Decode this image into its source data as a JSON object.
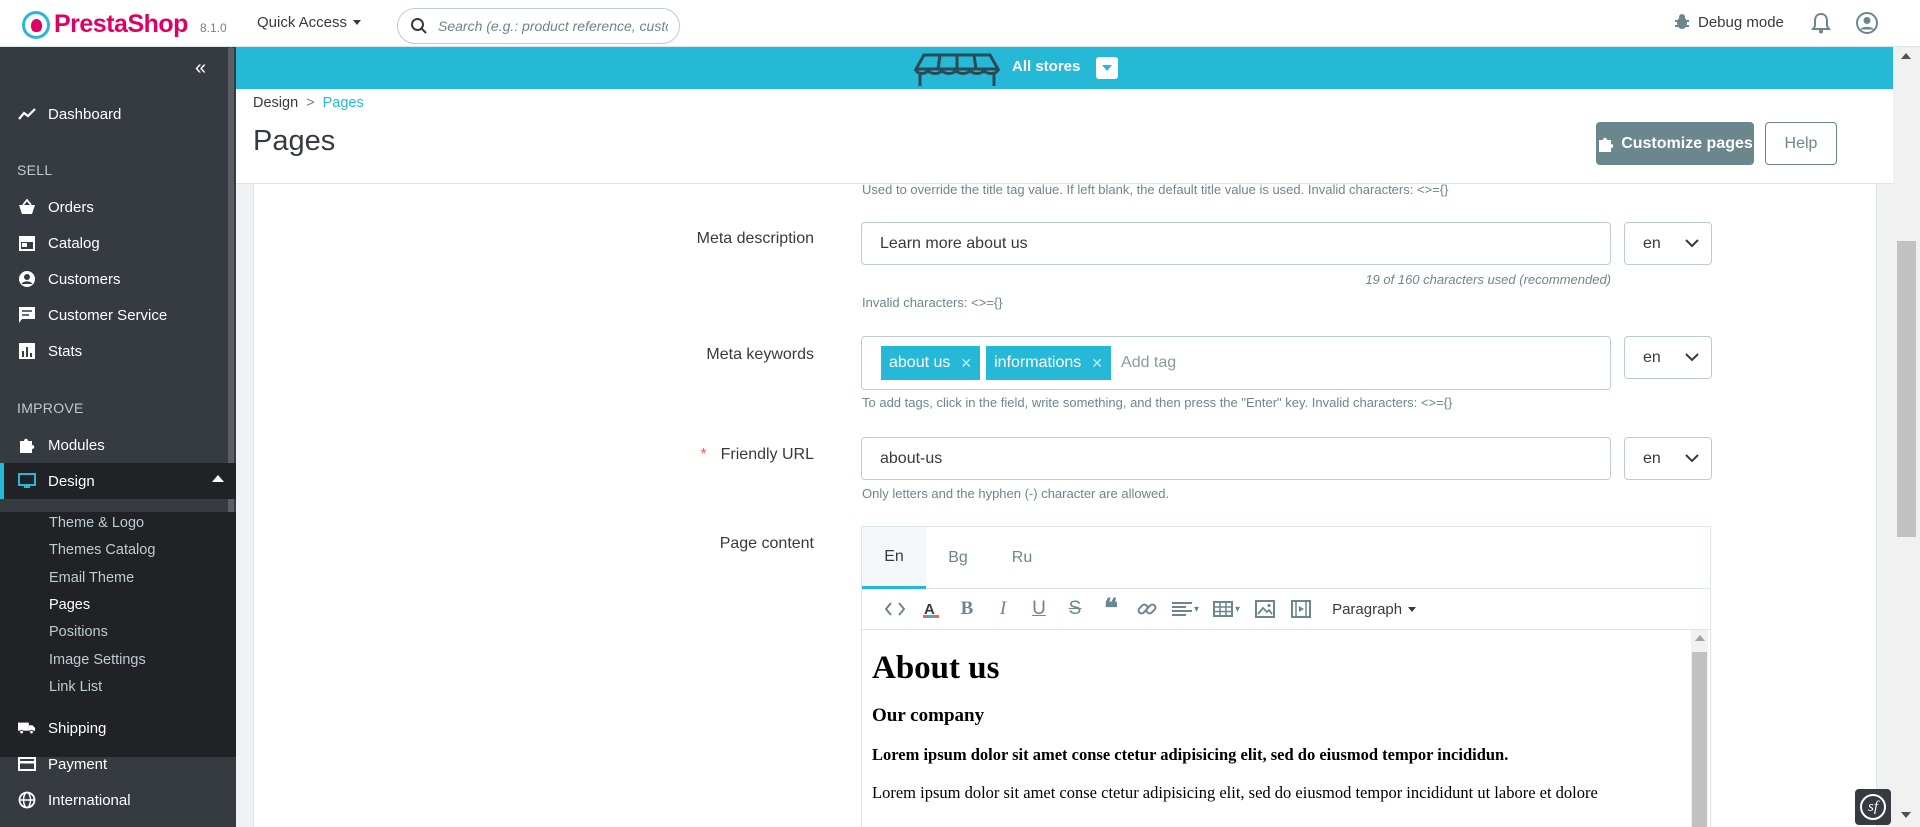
{
  "app": {
    "brand": "PrestaShop",
    "version": "8.1.0",
    "quick_access": "Quick Access",
    "search_placeholder": "Search (e.g.: product reference, custon",
    "debug_mode": "Debug mode"
  },
  "store_banner": {
    "label": "All stores"
  },
  "sidebar": {
    "items": [
      {
        "label": "Dashboard",
        "icon": "trending-up-icon"
      },
      {
        "label": "Orders",
        "icon": "basket-icon"
      },
      {
        "label": "Catalog",
        "icon": "store-icon"
      },
      {
        "label": "Customers",
        "icon": "account-circle-icon"
      },
      {
        "label": "Customer Service",
        "icon": "chat-icon"
      },
      {
        "label": "Stats",
        "icon": "bar-chart-icon"
      },
      {
        "label": "Modules",
        "icon": "puzzle-icon"
      },
      {
        "label": "Design",
        "icon": "desktop-icon"
      },
      {
        "label": "Shipping",
        "icon": "truck-icon"
      },
      {
        "label": "Payment",
        "icon": "credit-card-icon"
      },
      {
        "label": "International",
        "icon": "globe-icon"
      }
    ],
    "headings": {
      "sell": "SELL",
      "improve": "IMPROVE"
    },
    "design_submenu": [
      "Theme & Logo",
      "Themes Catalog",
      "Email Theme",
      "Pages",
      "Positions",
      "Image Settings",
      "Link List"
    ]
  },
  "header": {
    "breadcrumb": [
      "Design",
      "Pages"
    ],
    "title": "Pages",
    "customize_button": "Customize pages",
    "help_button": "Help"
  },
  "form": {
    "meta_title_help": "Used to override the title tag value. If left blank, the default title value is used. Invalid characters: <>={}",
    "meta_description": {
      "label": "Meta description",
      "value": "Learn more about us",
      "counter": "19 of 160 characters used (recommended)",
      "help": "Invalid characters: <>={}",
      "lang": "en"
    },
    "meta_keywords": {
      "label": "Meta keywords",
      "tags": [
        "about us",
        "informations"
      ],
      "placeholder": "Add tag",
      "help": "To add tags, click in the field, write something, and then press the \"Enter\" key. Invalid characters: <>={}",
      "lang": "en"
    },
    "friendly_url": {
      "required_mark": "*",
      "label": "Friendly URL",
      "value": "about-us",
      "help": "Only letters and the hyphen (-) character are allowed.",
      "lang": "en"
    },
    "page_content": {
      "label": "Page content",
      "tabs": [
        "En",
        "Bg",
        "Ru"
      ],
      "format": "Paragraph",
      "h1": "About us",
      "h2": "Our company",
      "lead": "Lorem ipsum dolor sit amet conse ctetur adipisicing elit, sed do eiusmod tempor incididun.",
      "body": "Lorem ipsum dolor sit amet conse ctetur adipisicing elit, sed do eiusmod tempor incididunt ut labore et dolore"
    }
  },
  "colors": {
    "accent": "#25b9d7",
    "sidebar": "#363a41",
    "brand": "#df0067"
  }
}
